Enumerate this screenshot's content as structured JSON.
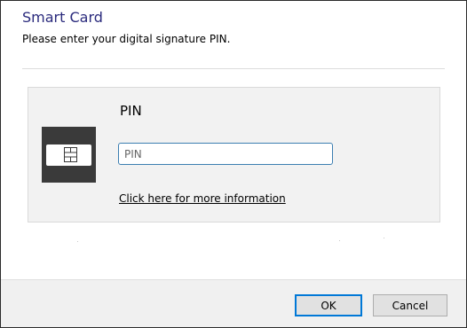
{
  "dialog": {
    "title": "Smart Card",
    "subtitle": "Please enter your digital signature PIN."
  },
  "credential": {
    "heading": "PIN",
    "pin_field": {
      "value": "",
      "placeholder": "PIN"
    },
    "more_info_link": "Click here for more information",
    "icon": "smart-card-icon"
  },
  "footer": {
    "ok_label": "OK",
    "cancel_label": "Cancel"
  },
  "colors": {
    "title": "#2b2b7d",
    "card_tile": "#3a3a3a",
    "input_focus_border": "#3c7fb1",
    "default_button_border": "#0078d7"
  }
}
